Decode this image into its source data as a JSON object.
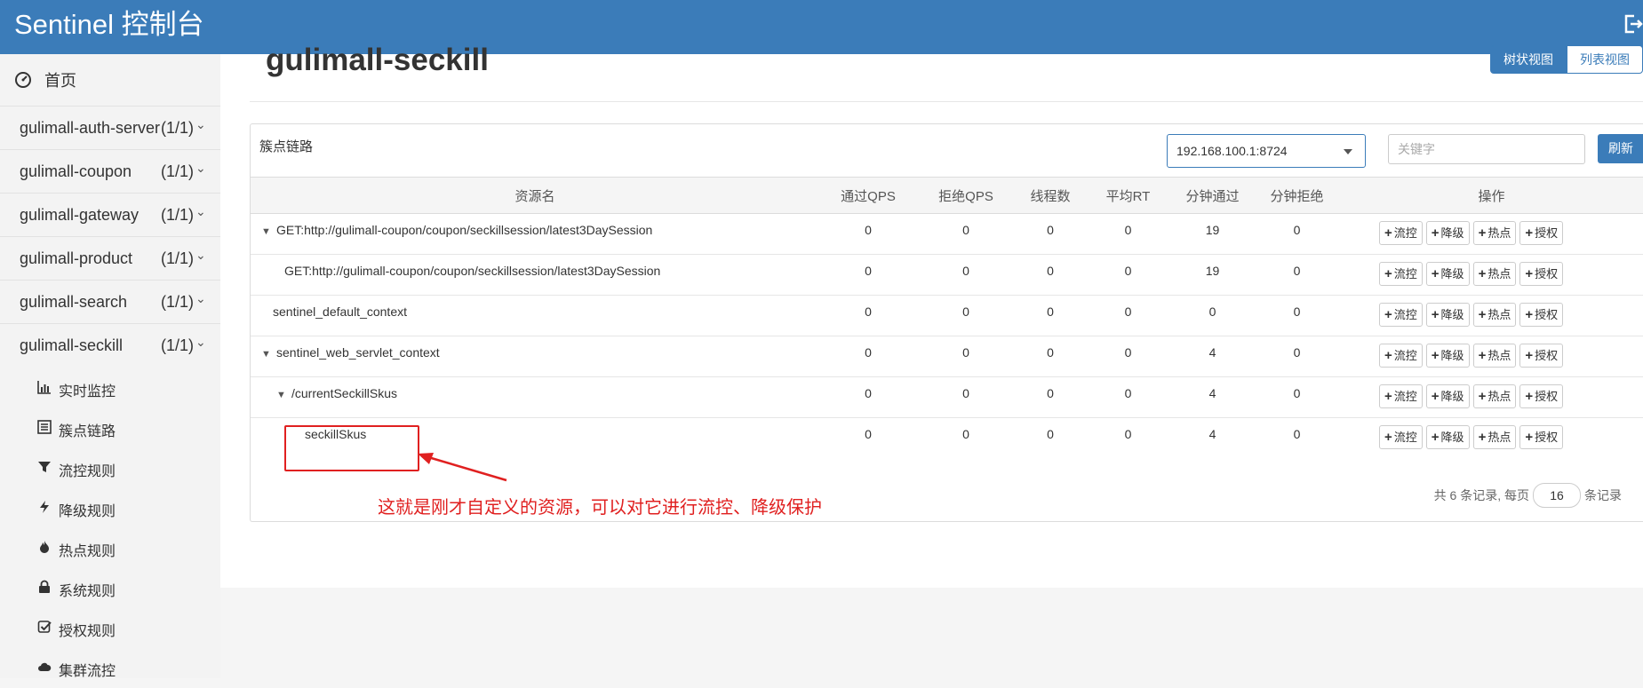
{
  "header": {
    "brand": "Sentinel 控制台",
    "logout_icon": "sign-out-icon"
  },
  "sidebar": {
    "home_label": "首页",
    "apps": [
      {
        "name": "gulimall-auth-server",
        "count": "(1/1)"
      },
      {
        "name": "gulimall-coupon",
        "count": "(1/1)"
      },
      {
        "name": "gulimall-gateway",
        "count": "(1/1)"
      },
      {
        "name": "gulimall-product",
        "count": "(1/1)"
      },
      {
        "name": "gulimall-search",
        "count": "(1/1)"
      },
      {
        "name": "gulimall-seckill",
        "count": "(1/1)"
      }
    ],
    "sub_items": [
      "实时监控",
      "簇点链路",
      "流控规则",
      "降级规则",
      "热点规则",
      "系统规则",
      "授权规则",
      "集群流控"
    ]
  },
  "main": {
    "title": "gulimall-seckill",
    "view_tree": "树状视图",
    "view_list": "列表视图",
    "panel_title": "簇点链路",
    "machine": "192.168.100.1:8724",
    "keyword_placeholder": "关键字",
    "refresh": "刷新",
    "columns": [
      "资源名",
      "通过QPS",
      "拒绝QPS",
      "线程数",
      "平均RT",
      "分钟通过",
      "分钟拒绝",
      "操作"
    ],
    "op_labels": {
      "flow": "流控",
      "degrade": "降级",
      "hot": "热点",
      "auth": "授权"
    },
    "rows": [
      {
        "name": "GET:http://gulimall-coupon/coupon/seckillsession/latest3DaySession",
        "pass_qps": "0",
        "block_qps": "0",
        "threads": "0",
        "avg_rt": "0",
        "min_pass": "19",
        "min_block": "0"
      },
      {
        "name": "GET:http://gulimall-coupon/coupon/seckillsession/latest3DaySession",
        "pass_qps": "0",
        "block_qps": "0",
        "threads": "0",
        "avg_rt": "0",
        "min_pass": "19",
        "min_block": "0"
      },
      {
        "name": "sentinel_default_context",
        "pass_qps": "0",
        "block_qps": "0",
        "threads": "0",
        "avg_rt": "0",
        "min_pass": "0",
        "min_block": "0"
      },
      {
        "name": "sentinel_web_servlet_context",
        "pass_qps": "0",
        "block_qps": "0",
        "threads": "0",
        "avg_rt": "0",
        "min_pass": "4",
        "min_block": "0"
      },
      {
        "name": "/currentSeckillSkus",
        "pass_qps": "0",
        "block_qps": "0",
        "threads": "0",
        "avg_rt": "0",
        "min_pass": "4",
        "min_block": "0"
      },
      {
        "name": "seckillSkus",
        "pass_qps": "0",
        "block_qps": "0",
        "threads": "0",
        "avg_rt": "0",
        "min_pass": "4",
        "min_block": "0"
      }
    ],
    "pager": {
      "prefix": "共 6 条记录, 每页",
      "page_size": "16",
      "suffix": "条记录"
    }
  },
  "annotation": {
    "text": "这就是刚才自定义的资源，可以对它进行流控、降级保护",
    "color": "#e02020"
  },
  "colors": {
    "brand": "#3b7cb9",
    "annotation": "#e02020"
  }
}
